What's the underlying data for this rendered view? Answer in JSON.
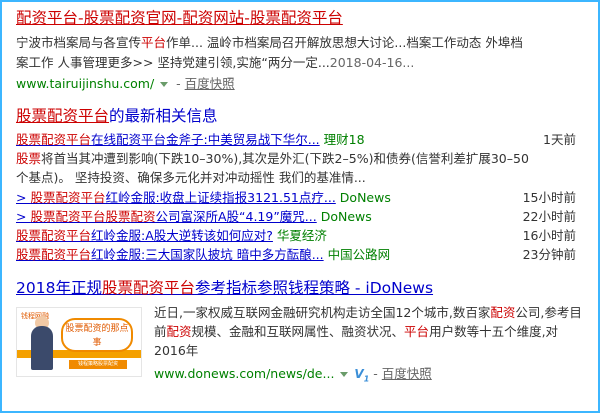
{
  "result1": {
    "title_pre": "",
    "title_h1": "配资平台",
    "title_mid1": "-",
    "title_h2": "股票配资",
    "title_mid2": "官网-",
    "title_h3": "配资",
    "title_mid3": "网站-",
    "title_h4": "股票配资平台",
    "abs1_a": "宁波市档案局与各宣传",
    "abs1_hl": "平台",
    "abs1_b": "作单... 温岭市档案局召开解放思想大讨论...档案工作动态 外埠档",
    "abs2": "案工作 人事管理更多>> 坚持党建引领,实施“两分一定...",
    "abs2_date": "2018-04-16...",
    "url": "www.tairuijinshu.com/",
    "snapshot_sep": " - ",
    "snapshot": "百度快照"
  },
  "news": {
    "head_hl": "股票配资平台",
    "head_rest": "的最新相关信息",
    "row1": {
      "hl": "股票配资平台",
      "rest": "在线配资平台金斧子:中美贸易战下华尔...",
      "src": "理财18",
      "time": "1天前"
    },
    "snippet1_hl": "股票",
    "snippet1_a": "将首当其冲遭到影响(下跌10–30%),其次是外汇(下跌2–5%)和债券(信誉利差扩展30–50",
    "snippet1_b": "个基点)。 坚持投资、确保多元化并对冲动摇性 我们的基准情...",
    "row2": {
      "pre": "> ",
      "hl": "股票配资平台",
      "rest": "红岭金服:收盘上证续指报3121.51点疗...",
      "src": "DoNews",
      "time": "15小时前"
    },
    "row3": {
      "pre": "> ",
      "hl": "股票配资平台股票配资",
      "rest": "公司富深所A股“4.19”魔咒...",
      "src": "DoNews",
      "time": "22小时前"
    },
    "row4": {
      "pre": "",
      "hl": "股票配资平台",
      "rest": "红岭金服:A股大逆转该如何应对?",
      "src": "华夏经济",
      "time": "16小时前"
    },
    "row5": {
      "pre": "",
      "hl": "股票配资平台",
      "rest": "红岭金服:三大国家队披坑 暗中多方酝酿...",
      "src": "中国公路网",
      "time": "23分钟前"
    }
  },
  "result3": {
    "title_a": "2018年正规",
    "title_hl": "股票配资平台",
    "title_b": "参考指标参照钱程策略 - iDoNews",
    "thumb_logo": "钱程网融",
    "thumb_bubble": "股票配资的那点事",
    "thumb_plate": "钱程策略股票配资",
    "text_a": "近日,一家权威互联网金融研究机构走访全国12个城市,数百家",
    "text_hl1": "配资",
    "text_b": "公司,参考目前",
    "text_hl2": "配资",
    "text_c": "规模、金融和互联网属性、融资状况、",
    "text_hl3": "平台",
    "text_d": "用户数等十五个维度,对2016年",
    "url": "www.donews.com/news/de...",
    "badge": "V",
    "badge_sub": "1",
    "snapshot_sep": " - ",
    "snapshot": "百度快照"
  }
}
